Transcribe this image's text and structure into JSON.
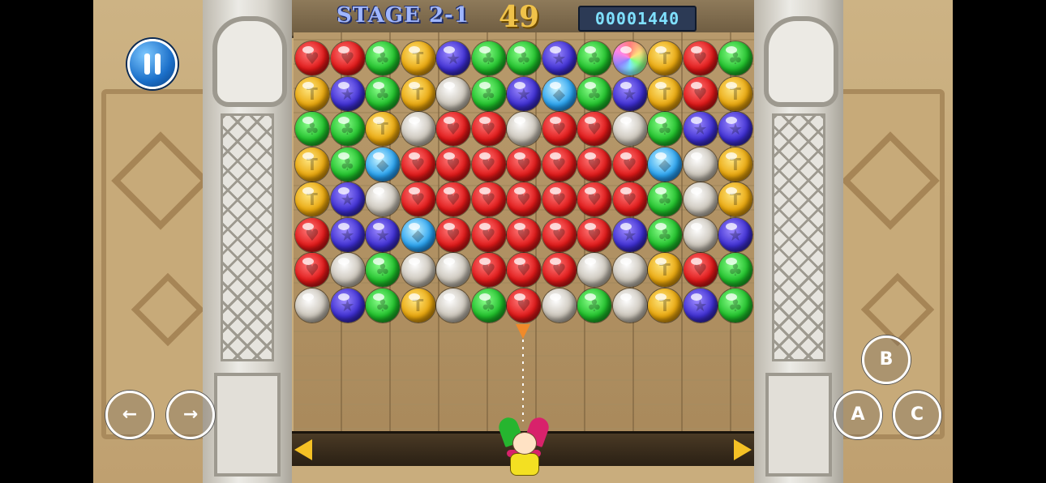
{
  "hud": {
    "stage": "STAGE 2-1",
    "timer": "49",
    "score": "00001440"
  },
  "controls": {
    "left": "←",
    "right": "→",
    "a": "A",
    "b": "B",
    "c": "C"
  },
  "board": {
    "rows": [
      [
        "red",
        "red",
        "green",
        "yellow",
        "purple",
        "green",
        "green",
        "purple",
        "green",
        "rainbow",
        "yellow",
        "red",
        "green"
      ],
      [
        "yellow",
        "purple",
        "green",
        "yellow",
        "silver",
        "green",
        "purple",
        "blue",
        "green",
        "purple",
        "yellow",
        "red",
        "yellow"
      ],
      [
        "green",
        "green",
        "yellow",
        "silver",
        "red",
        "red",
        "silver",
        "red",
        "red",
        "silver",
        "green",
        "purple",
        "purple"
      ],
      [
        "yellow",
        "green",
        "blue",
        "red",
        "red",
        "red",
        "red",
        "red",
        "red",
        "red",
        "blue",
        "silver",
        "yellow"
      ],
      [
        "yellow",
        "purple",
        "silver",
        "red",
        "red",
        "red",
        "red",
        "red",
        "red",
        "red",
        "green",
        "silver",
        "yellow"
      ],
      [
        "red",
        "purple",
        "purple",
        "blue",
        "red",
        "red",
        "red",
        "red",
        "red",
        "purple",
        "green",
        "silver",
        "purple"
      ],
      [
        "red",
        "silver",
        "green",
        "silver",
        "silver",
        "red",
        "red",
        "red",
        "silver",
        "silver",
        "yellow",
        "red",
        "green"
      ],
      [
        "silver",
        "purple",
        "green",
        "yellow",
        "silver",
        "green",
        "red",
        "silver",
        "green",
        "silver",
        "yellow",
        "purple",
        "green"
      ]
    ]
  },
  "colors": {
    "red": "#e01818",
    "green": "#1fbf2a",
    "yellow": "#e9a70d",
    "purple": "#3d2ed1",
    "silver": "#c9c3b8",
    "blue": "#2aa3f0"
  }
}
